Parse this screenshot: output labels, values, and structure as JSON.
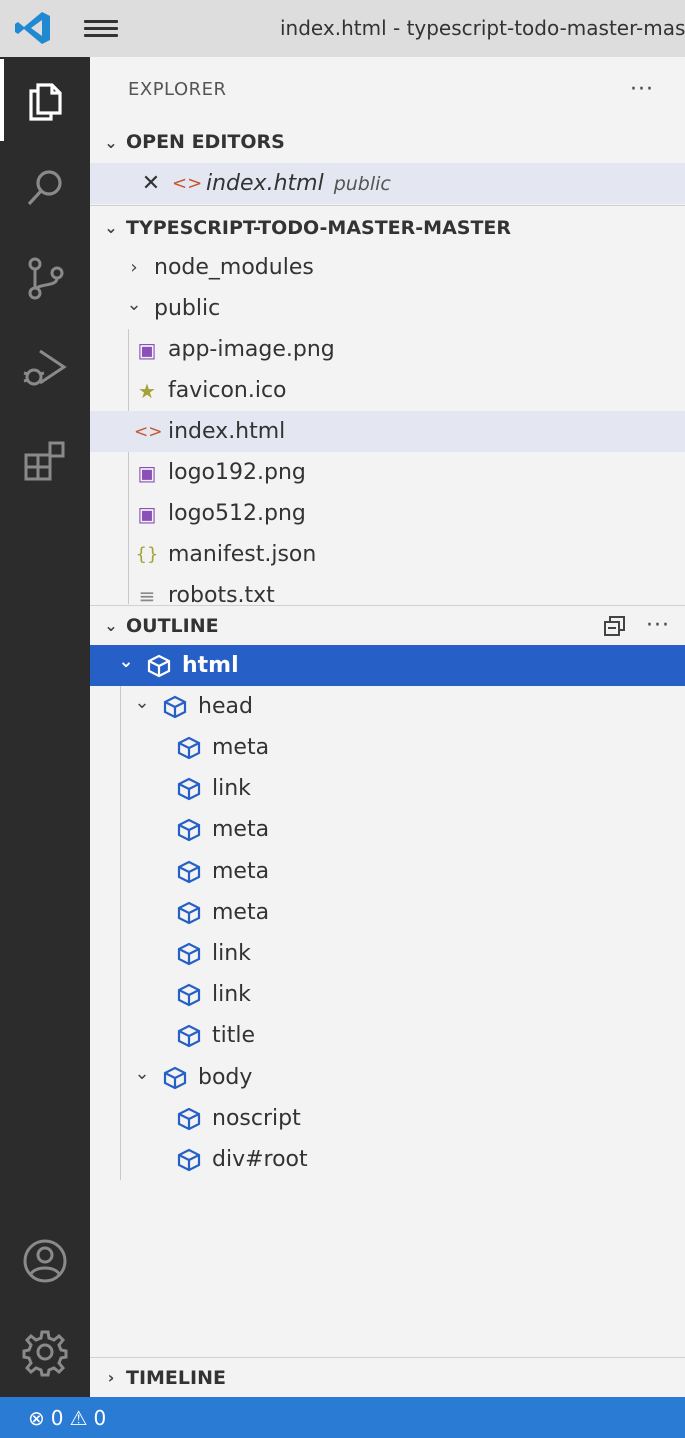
{
  "window": {
    "title": "index.html - typescript-todo-master-master"
  },
  "activity": [
    "explorer-icon",
    "search-icon",
    "source-control-icon",
    "run-debug-icon",
    "extensions-icon",
    "account-icon",
    "gear-icon"
  ],
  "explorer": {
    "header": "EXPLORER",
    "more": "···"
  },
  "open_editors": {
    "title": "OPEN EDITORS",
    "items": [
      {
        "name": "index.html",
        "desc": "public",
        "close": "✕",
        "icon": "<>"
      }
    ]
  },
  "project": {
    "title": "TYPESCRIPT-TODO-MASTER-MASTER",
    "folders": [
      {
        "name": "node_modules",
        "chevron": "›"
      },
      {
        "name": "public",
        "chevron": "⌄"
      }
    ],
    "files": [
      {
        "name": "app-image.png",
        "icon": "image-icon"
      },
      {
        "name": "favicon.ico",
        "icon": "star-icon"
      },
      {
        "name": "index.html",
        "icon": "html-icon"
      },
      {
        "name": "logo192.png",
        "icon": "image-icon"
      },
      {
        "name": "logo512.png",
        "icon": "image-icon"
      },
      {
        "name": "manifest.json",
        "icon": "json-icon"
      },
      {
        "name": "robots.txt",
        "icon": "text-icon"
      }
    ]
  },
  "outline": {
    "title": "OUTLINE",
    "more": "···",
    "nodes": [
      "html",
      "head",
      "meta",
      "link",
      "meta",
      "meta",
      "meta",
      "link",
      "link",
      "title",
      "body",
      "noscript",
      "div#root"
    ]
  },
  "timeline": {
    "title": "TIMELINE"
  },
  "status": {
    "errors": "0",
    "warnings": "0"
  },
  "colors": {
    "accent": "#2660c7",
    "statusbar": "#2a7bd4",
    "activitybar": "#2c2c2c"
  }
}
